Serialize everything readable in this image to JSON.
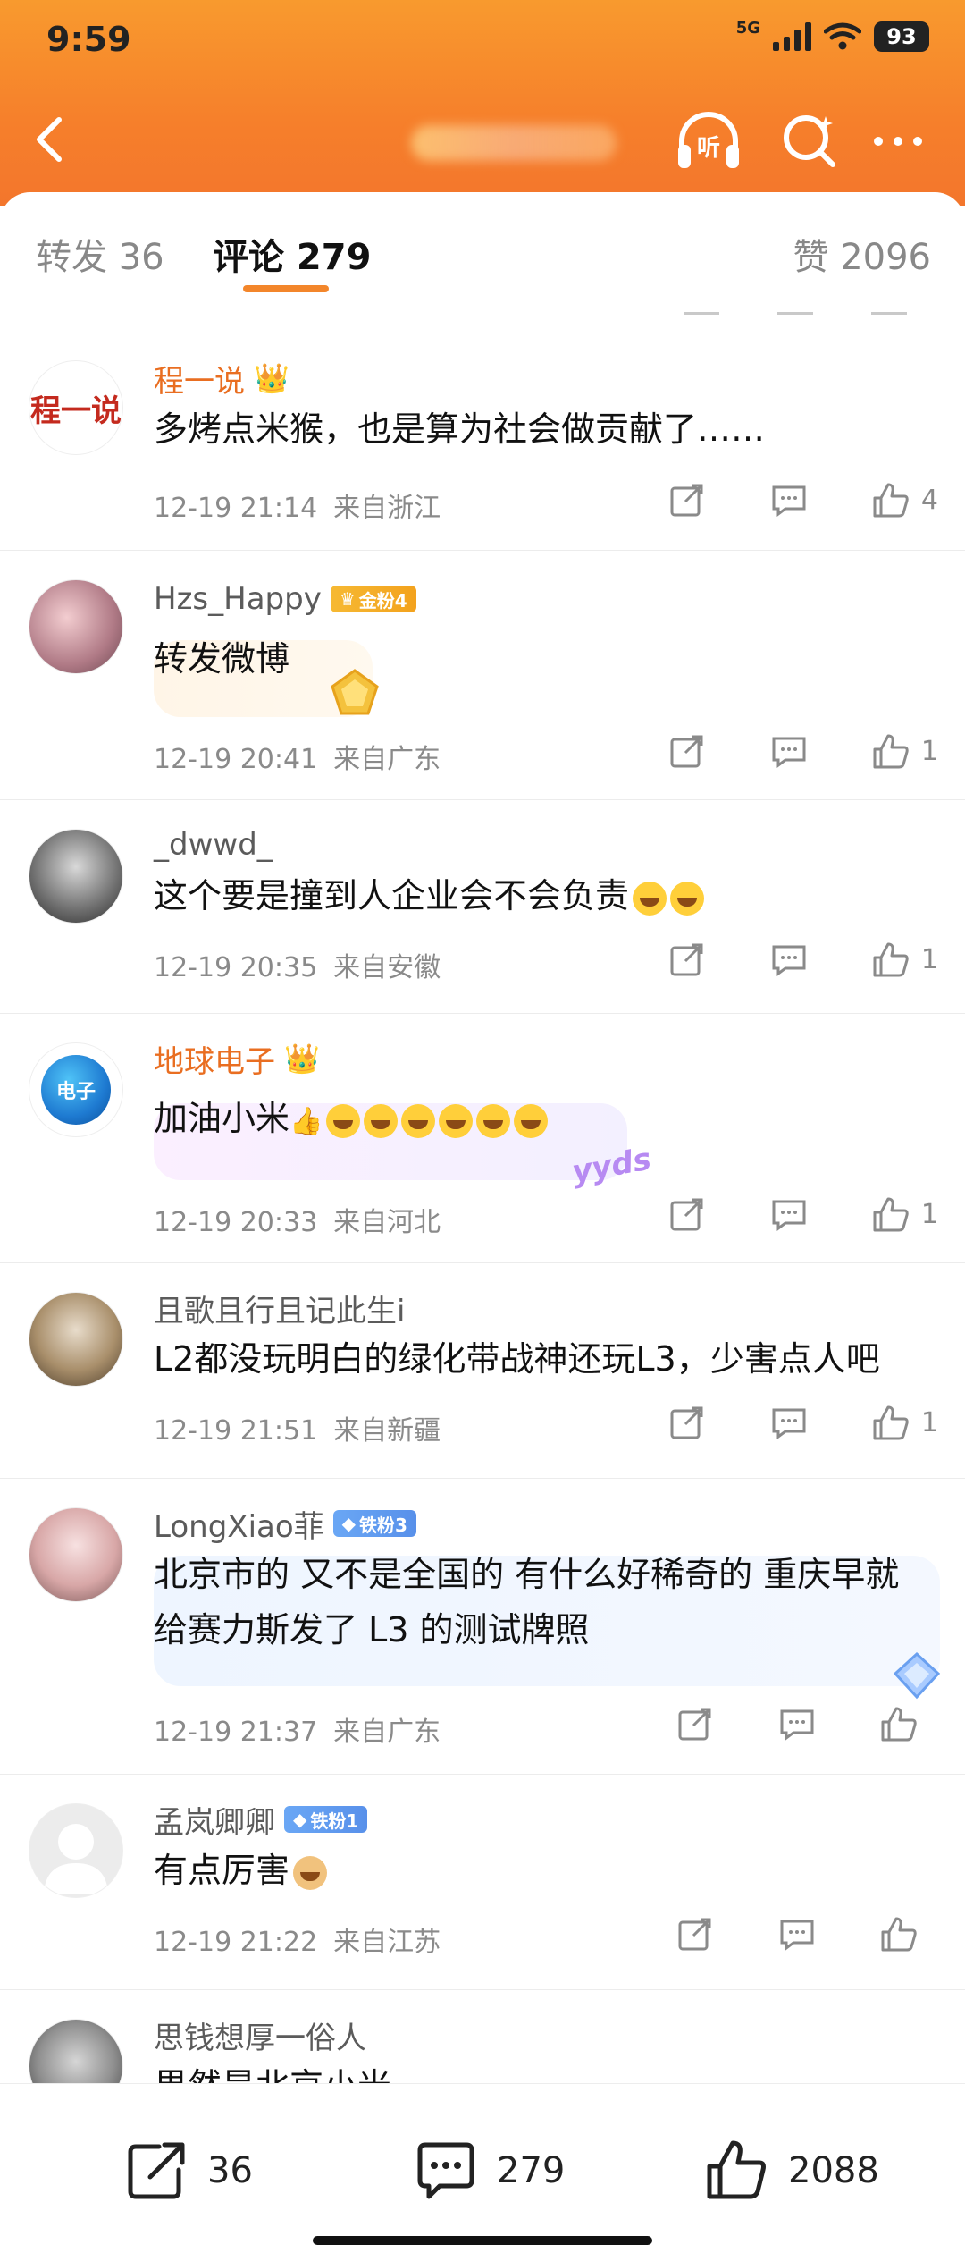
{
  "status": {
    "time": "9:59",
    "network": "5G",
    "battery": "93"
  },
  "tabs": {
    "repost": "转发 36",
    "comments": "评论 279",
    "likes": "赞 2096"
  },
  "comments": [
    {
      "username": "程一说",
      "avatar_text": "程一说",
      "text": "多烤点米猴，也是算为社会做贡献了……",
      "time": "12-19 21:14",
      "location": "来自浙江",
      "likes": "4"
    },
    {
      "username": "Hzs_Happy",
      "badge": "金粉4",
      "text": "转发微博",
      "time": "12-19 20:41",
      "location": "来自广东",
      "likes": "1"
    },
    {
      "username": "_dwwd_",
      "text": "这个要是撞到人企业会不会负责",
      "time": "12-19 20:35",
      "location": "来自安徽",
      "likes": "1"
    },
    {
      "username": "地球电子",
      "avatar_text": "电子",
      "text": "加油小米",
      "time": "12-19 20:33",
      "location": "来自河北",
      "likes": "1",
      "sticker": "yyds"
    },
    {
      "username": "且歌且行且记此生i",
      "text": "L2都没玩明白的绿化带战神还玩L3，少害点人吧",
      "time": "12-19 21:51",
      "location": "来自新疆",
      "likes": "1"
    },
    {
      "username": "LongXiao菲",
      "badge": "铁粉3",
      "text": "北京市的  又不是全国的  有什么好稀奇的   重庆早就给赛力斯发了 L3 的测试牌照",
      "time": "12-19 21:37",
      "location": "来自广东",
      "likes": ""
    },
    {
      "username": "孟岚卿卿",
      "badge": "铁粉1",
      "text": "有点厉害",
      "time": "12-19 21:22",
      "location": "来自江苏",
      "likes": ""
    },
    {
      "username": "思钱想厚一俗人",
      "text": "果然是北京小米",
      "time": "",
      "location": "",
      "likes": ""
    }
  ],
  "bottom_bar": {
    "repost_count": "36",
    "comment_count": "279",
    "like_count": "2088"
  },
  "colors": {
    "header_orange": "#f67f2b",
    "accent_orange": "#e96e21",
    "tab_indicator": "#f3862b"
  }
}
